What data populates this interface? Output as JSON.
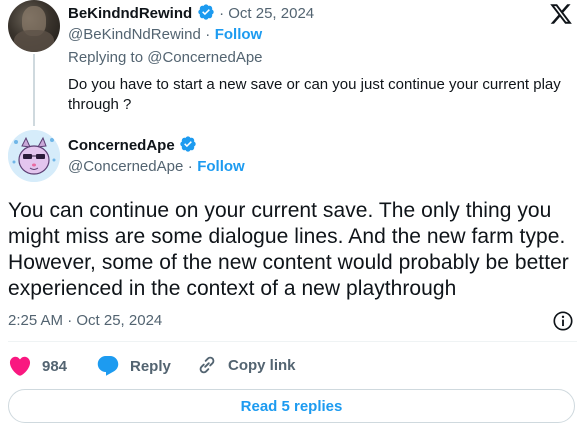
{
  "parent": {
    "display_name": "BeKindndRewind",
    "date": "· Oct 25, 2024",
    "handle": "@BeKindNdRewind",
    "follow_label": "Follow",
    "replying_to": "Replying to @ConcernedApe",
    "text": "Do you have to start a new save or can you just continue your current play through ?"
  },
  "tweet": {
    "display_name": "ConcernedApe",
    "handle": "@ConcernedApe",
    "follow_label": "Follow",
    "text": "You can continue on your current save. The only thing you might miss are some dialogue lines. And the new farm type. However, some of the new content would probably be better experienced in the context of a new playthrough",
    "timestamp": "2:25 AM · Oct 25, 2024"
  },
  "actions": {
    "like_count": "984",
    "reply_label": "Reply",
    "copy_label": "Copy link"
  },
  "read_replies_label": "Read 5 replies",
  "icons": {
    "verified": "verified-badge-icon",
    "x_logo": "x-logo-icon",
    "info": "info-icon",
    "heart": "heart-icon",
    "reply": "reply-bubble-icon",
    "link": "link-icon"
  },
  "colors": {
    "accent": "#1d9bf0",
    "heart": "#f91880",
    "muted": "#536471",
    "text": "#0f1419"
  }
}
